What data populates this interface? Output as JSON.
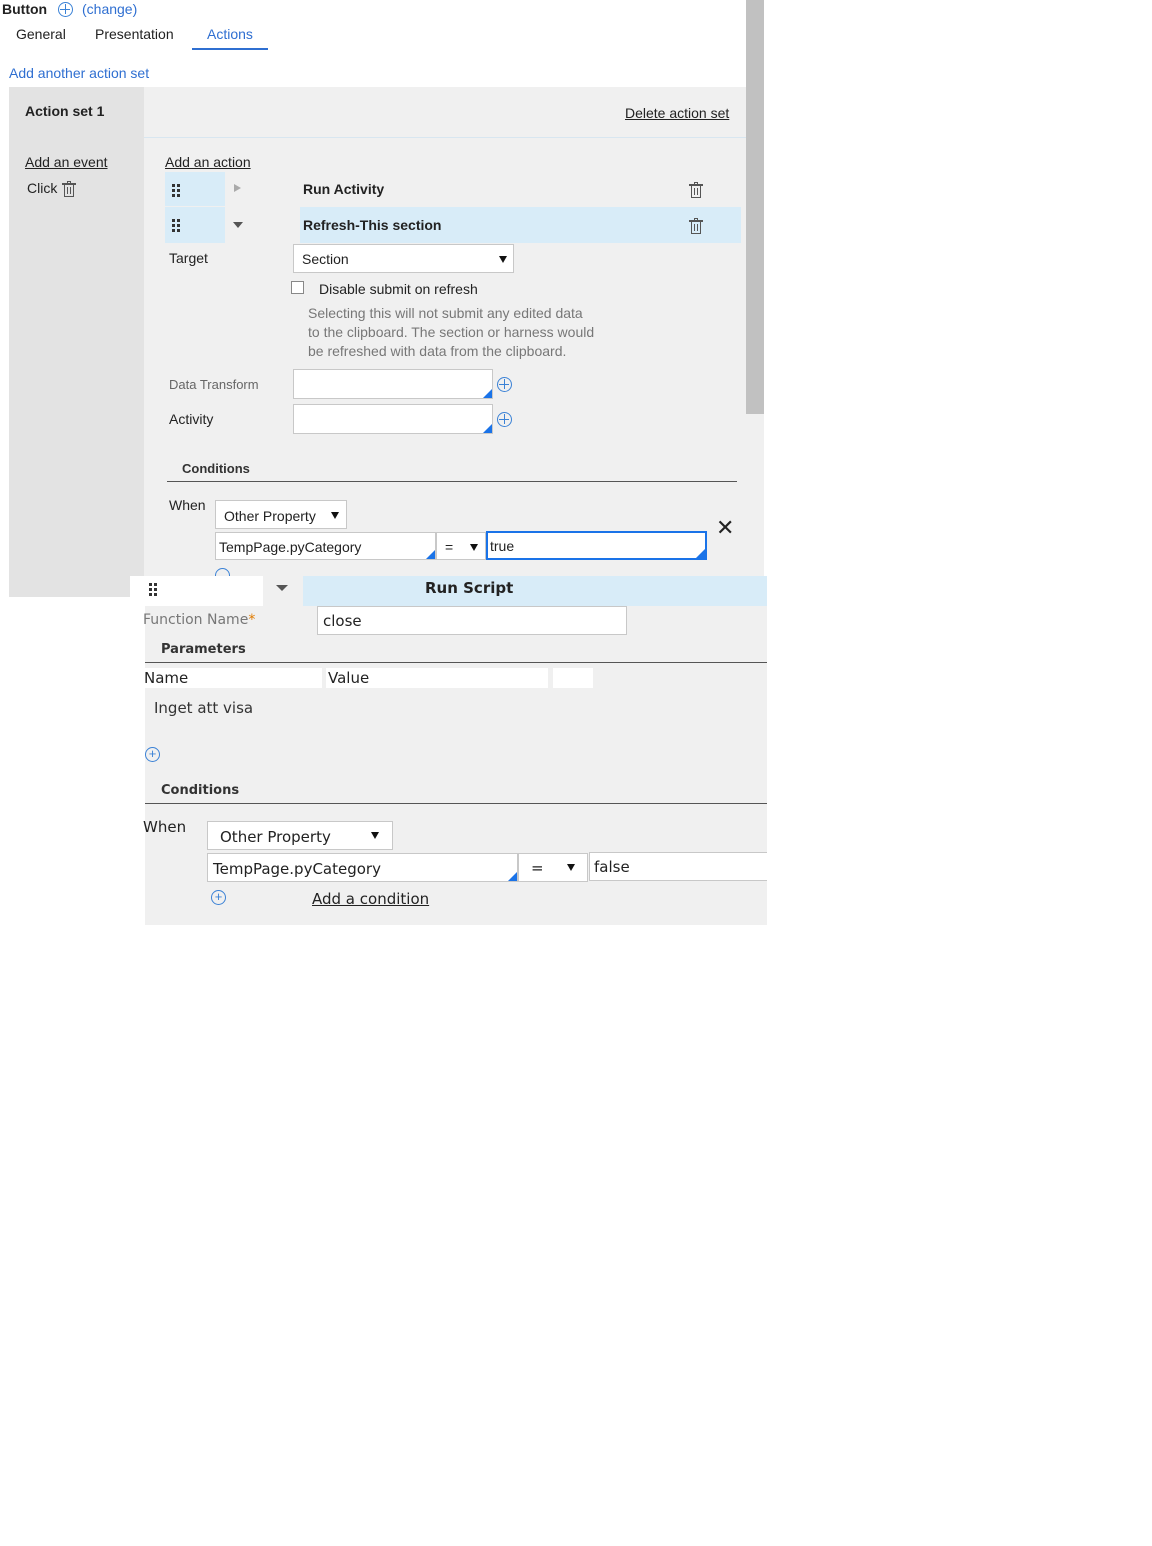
{
  "header": {
    "title": "Button",
    "change_link": "(change)"
  },
  "tabs": [
    {
      "label": "General"
    },
    {
      "label": "Presentation"
    },
    {
      "label": "Actions",
      "active": true
    }
  ],
  "add_action_set_link": "Add another action set",
  "action_set": {
    "title": "Action set 1",
    "delete_link": "Delete action set",
    "add_event_link": "Add an event",
    "event_label": "Click",
    "add_action_link": "Add an action",
    "actions": [
      {
        "label": "Run Activity",
        "expanded": false
      },
      {
        "label": "Refresh-This section",
        "expanded": true
      }
    ],
    "refresh": {
      "target_label": "Target",
      "target_value": "Section",
      "disable_submit_label": "Disable submit on refresh",
      "disable_submit_checked": false,
      "help_text_1": "Selecting this will not submit any edited data",
      "help_text_2": "to the clipboard. The section or harness would",
      "help_text_3": "be refreshed with data from the clipboard.",
      "data_transform_label": "Data Transform",
      "data_transform_value": "",
      "activity_label": "Activity",
      "activity_value": ""
    },
    "conditions": {
      "heading": "Conditions",
      "when_label": "When",
      "type_value": "Other Property",
      "property_value": "TempPage.pyCategory",
      "operator_value": "=",
      "compare_value": "true",
      "remove_icon": "close-icon"
    }
  },
  "run_script": {
    "title": "Run Script",
    "function_name_label": "Function Name",
    "required_marker": "*",
    "function_name_value": "close",
    "parameters_heading": "Parameters",
    "col_name": "Name",
    "col_value": "Value",
    "empty_text": "Inget att visa",
    "conditions": {
      "heading": "Conditions",
      "when_label": "When",
      "type_value": "Other Property",
      "property_value": "TempPage.pyCategory",
      "operator_value": "=",
      "compare_value": "false",
      "add_condition_link": "Add a condition"
    }
  },
  "colors": {
    "accent": "#2f6fd1",
    "selected_row": "#d8ecf8",
    "panel_gray": "#f0f0f0",
    "sidebar_gray": "#e3e3e3",
    "scrollbar": "#c1c1c1",
    "required": "#e07b00"
  }
}
